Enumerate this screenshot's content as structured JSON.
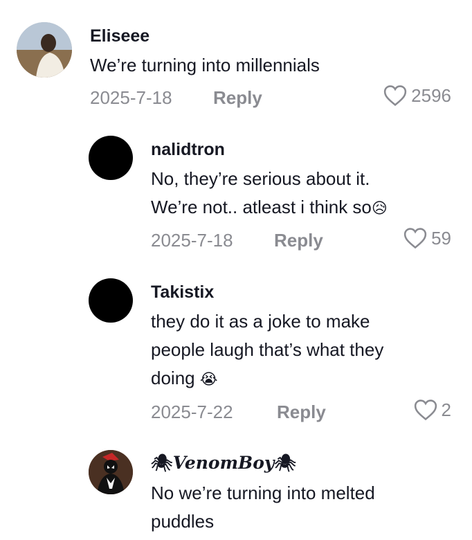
{
  "comments": [
    {
      "username": "Eliseee",
      "text": [
        "We’re turning into millennials"
      ],
      "date": "2025-7-18",
      "reply_label": "Reply",
      "likes": "2596"
    },
    {
      "username": "nalidtron",
      "text": [
        "No, they’re serious about it.",
        "We’re not.. atleast i think so"
      ],
      "emoji": "😥",
      "date": "2025-7-18",
      "reply_label": "Reply",
      "likes": "59"
    },
    {
      "username": "Takistix",
      "text": [
        "they do it as a joke to make",
        "people laugh that’s what they",
        "doing "
      ],
      "emoji": "😭",
      "date": "2025-7-22",
      "reply_label": "Reply",
      "likes": "2"
    },
    {
      "username_prefix": "🕷",
      "username": "VenomBoy",
      "username_suffix": "🕷",
      "text": [
        "No we’re turning into melted",
        "puddles"
      ]
    }
  ]
}
